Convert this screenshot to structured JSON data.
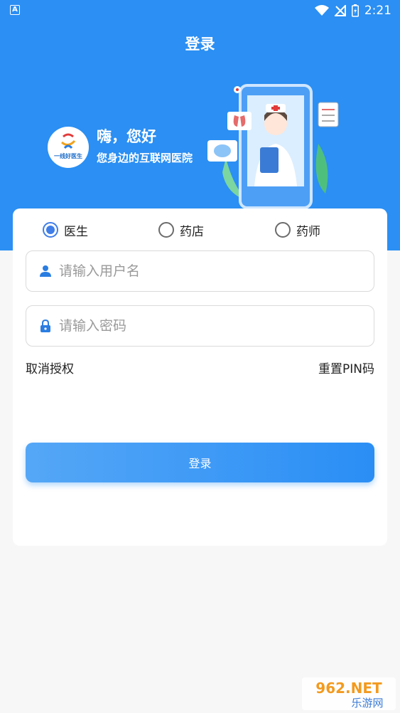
{
  "status_bar": {
    "time": "2:21",
    "notif_letter": "A"
  },
  "header": {
    "title": "登录"
  },
  "hero": {
    "greeting": "嗨，您好",
    "subtitle": "您身边的互联网医院",
    "logo_text": "一线好医生"
  },
  "role_options": [
    {
      "label": "医生",
      "checked": true
    },
    {
      "label": "药店",
      "checked": false
    },
    {
      "label": "药师",
      "checked": false
    }
  ],
  "username": {
    "placeholder": "请输入用户名",
    "value": ""
  },
  "password": {
    "placeholder": "请输入密码",
    "value": ""
  },
  "links": {
    "cancel_auth": "取消授权",
    "reset_pin": "重置PIN码"
  },
  "login_button": {
    "label": "登录"
  },
  "watermark": {
    "text_top": "962.NET",
    "text_bottom": "乐游网"
  },
  "colors": {
    "primary": "#2b8ff3",
    "radio_active": "#3f7ee8",
    "background": "#f7f7f8"
  }
}
